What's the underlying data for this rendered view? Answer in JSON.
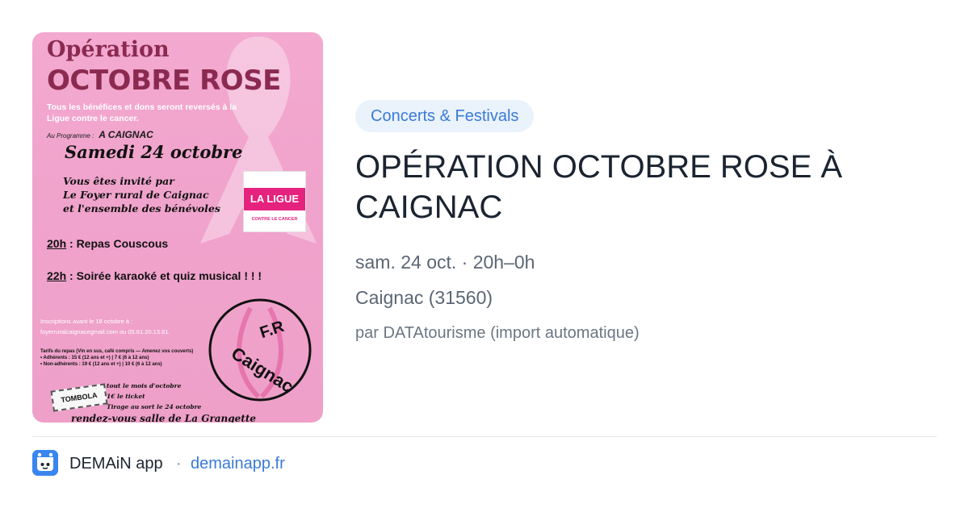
{
  "poster": {
    "title_line1": "Opération",
    "title_line2": "OCTOBRE ROSE",
    "benefits": "Tous les bénéfices et dons seront reversés à la Ligue contre le cancer.",
    "program_label": "Au Programme :",
    "program_place": "A CAIGNAC",
    "date": "Samedi 24 octobre",
    "invite_line1": "Vous êtes invité par",
    "invite_line2": "Le Foyer rural de Caignac",
    "invite_line3": "et l'ensemble des bénévoles",
    "ligue_label": "LA LIGUE",
    "ligue_sub": "CONTRE LE CANCER",
    "line1_time": "20h",
    "line1_text": " : Repas Couscous",
    "line2_time": "22h",
    "line2_text": " : Soirée karaoké  et  quiz musical  ! ! !",
    "inscription1": "Inscriptions avant le 18 octobre à :",
    "inscription2": "foyerruralcaignacegmail.com ou 05.61.20.13.61.",
    "tarifs_line1": "Tarifs du repas (Vin en sus, café compris — Amenez vos couverts)",
    "tarifs_line2": "• Adhérents : 15 € (12 ans et +) | 7 € (6 à 12 ans)",
    "tarifs_line3": "• Non-adhérents : 19 € (12 ans et +) | 10 € (6 à 12 ans)",
    "tombola_tag": "TOMBOLA",
    "tombola_line1": "tout le mois d'octobre",
    "tombola_line2": "1€ le ticket",
    "tombola_line3": "Tirage au sort le 24 octobre",
    "rdv": "rendez-vous salle de La Grangette",
    "logo_fr": "F.R",
    "logo_name": "Caignac",
    "accent_color": "#f0a3cc"
  },
  "event": {
    "category": "Concerts & Festivals",
    "title_line1": "OPÉRATION OCTOBRE ROSE À",
    "title_line2": "CAIGNAC",
    "datetime": "sam. 24 oct. · 20h–0h",
    "place": "Caignac (31560)",
    "byline": "par DATAtourisme (import automatique)"
  },
  "footer": {
    "app_name": "DEMAiN app",
    "separator": "·",
    "domain": "demainapp.fr",
    "accent_color": "#3a7bd5"
  }
}
